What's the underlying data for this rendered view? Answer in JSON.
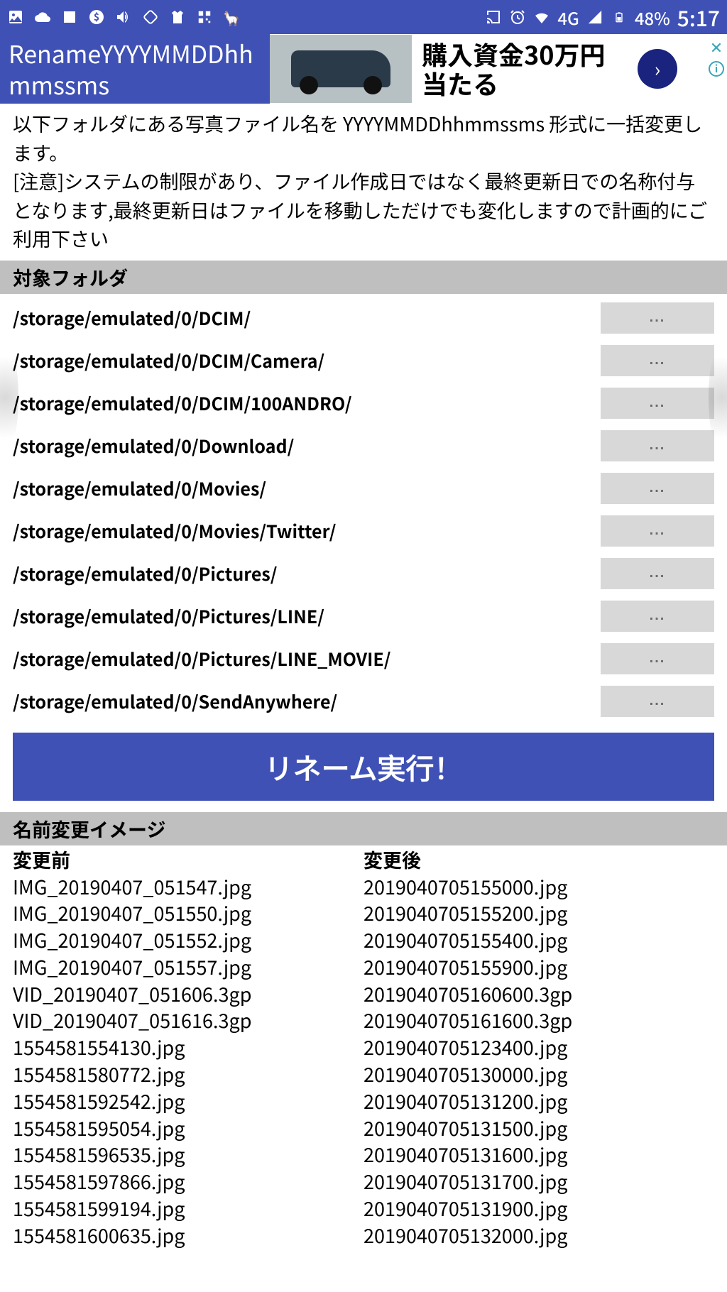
{
  "status": {
    "network": "4G",
    "battery": "48%",
    "time": "5:17"
  },
  "app": {
    "title": "RenameYYYYMMDDhhmmssms"
  },
  "ad": {
    "line1": "購入資金30万円",
    "line2": "当たる"
  },
  "description": "以下フォルダにある写真ファイル名を YYYYMMDDhhmmssms 形式に一括変更します。\n[注意]システムの制限があり、ファイル作成日ではなく最終更新日での名称付与となります,最終更新日はファイルを移動しただけでも変化しますので計画的にご利用下さい",
  "sections": {
    "folders_header": "対象フォルダ",
    "preview_header": "名前変更イメージ",
    "before_label": "変更前",
    "after_label": "変更後"
  },
  "folders": [
    "/storage/emulated/0/DCIM/",
    "/storage/emulated/0/DCIM/Camera/",
    "/storage/emulated/0/DCIM/100ANDRO/",
    "/storage/emulated/0/Download/",
    "/storage/emulated/0/Movies/",
    "/storage/emulated/0/Movies/Twitter/",
    "/storage/emulated/0/Pictures/",
    "/storage/emulated/0/Pictures/LINE/",
    "/storage/emulated/0/Pictures/LINE_MOVIE/",
    "/storage/emulated/0/SendAnywhere/"
  ],
  "folder_button_label": "...",
  "execute_label": "リネーム実行！",
  "preview": {
    "before": [
      "IMG_20190407_051547.jpg",
      "IMG_20190407_051550.jpg",
      "IMG_20190407_051552.jpg",
      "IMG_20190407_051557.jpg",
      "VID_20190407_051606.3gp",
      "VID_20190407_051616.3gp",
      "1554581554130.jpg",
      "1554581580772.jpg",
      "1554581592542.jpg",
      "1554581595054.jpg",
      "1554581596535.jpg",
      "1554581597866.jpg",
      "1554581599194.jpg",
      "1554581600635.jpg"
    ],
    "after": [
      "2019040705155000.jpg",
      "2019040705155200.jpg",
      "2019040705155400.jpg",
      "2019040705155900.jpg",
      "2019040705160600.3gp",
      "2019040705161600.3gp",
      "2019040705123400.jpg",
      "2019040705130000.jpg",
      "2019040705131200.jpg",
      "2019040705131500.jpg",
      "2019040705131600.jpg",
      "2019040705131700.jpg",
      "2019040705131900.jpg",
      "2019040705132000.jpg"
    ]
  }
}
